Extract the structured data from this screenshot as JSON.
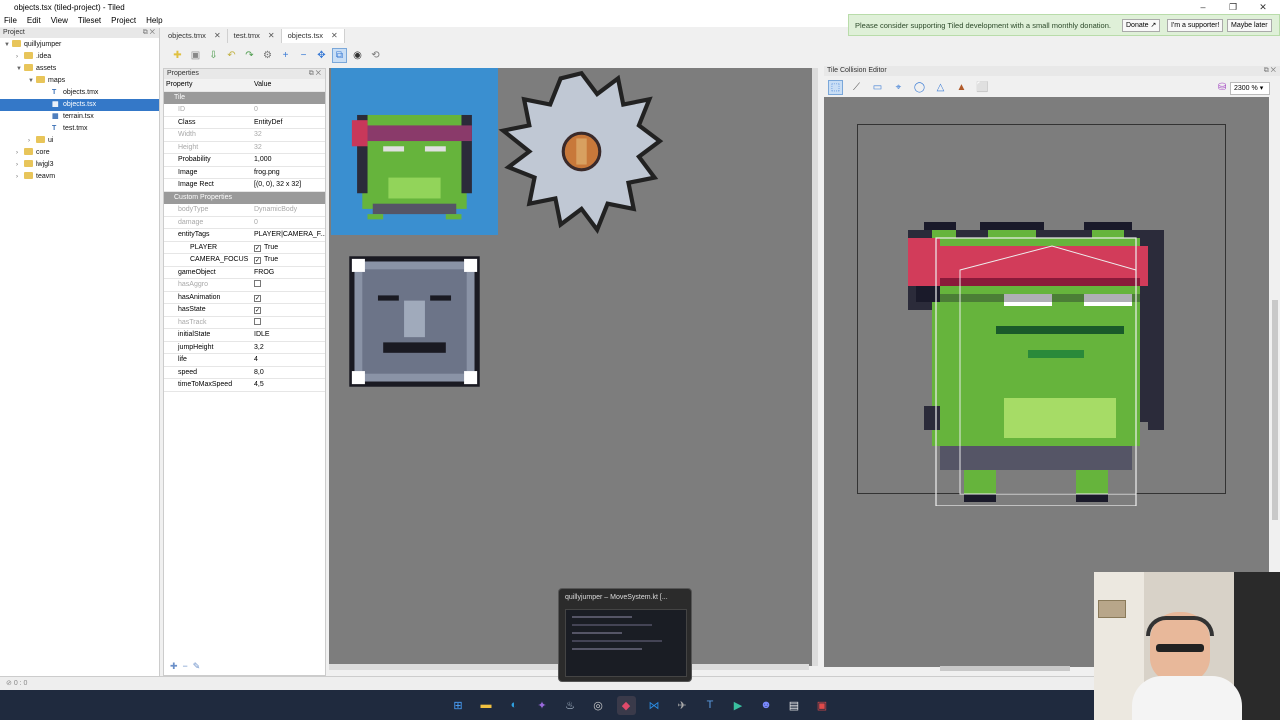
{
  "window": {
    "title": "objects.tsx (tiled-project) - Tiled"
  },
  "menu": [
    "File",
    "Edit",
    "View",
    "Tileset",
    "Project",
    "Help"
  ],
  "banner": {
    "text": "Please consider supporting Tiled development with a small monthly donation.",
    "donate": "Donate ↗",
    "supporter": "I'm a supporter!",
    "later": "Maybe later"
  },
  "tabs": [
    {
      "label": "objects.tmx"
    },
    {
      "label": "test.tmx"
    },
    {
      "label": "objects.tsx"
    }
  ],
  "project": {
    "header": "Project",
    "tree": [
      {
        "label": "quillyjumper",
        "type": "folder"
      },
      {
        "label": ".idea",
        "type": "folder"
      },
      {
        "label": "assets",
        "type": "folder"
      },
      {
        "label": "maps",
        "type": "folder"
      },
      {
        "label": "objects.tmx",
        "type": "file"
      },
      {
        "label": "objects.tsx",
        "type": "file"
      },
      {
        "label": "terrain.tsx",
        "type": "file"
      },
      {
        "label": "test.tmx",
        "type": "file"
      },
      {
        "label": "ui",
        "type": "folder"
      },
      {
        "label": "core",
        "type": "folder"
      },
      {
        "label": "lwjgl3",
        "type": "folder"
      },
      {
        "label": "teavm",
        "type": "folder"
      }
    ]
  },
  "properties": {
    "header": "Properties",
    "col_property": "Property",
    "col_value": "Value",
    "rows": [
      {
        "name": "Tile",
        "value": "",
        "kind": "group"
      },
      {
        "name": "ID",
        "value": "0",
        "kind": "disabled"
      },
      {
        "name": "Class",
        "value": "EntityDef",
        "kind": "normal"
      },
      {
        "name": "Width",
        "value": "32",
        "kind": "disabled"
      },
      {
        "name": "Height",
        "value": "32",
        "kind": "disabled"
      },
      {
        "name": "Probability",
        "value": "1,000",
        "kind": "normal"
      },
      {
        "name": "Image",
        "value": "frog.png",
        "kind": "normal"
      },
      {
        "name": "Image Rect",
        "value": "[(0, 0), 32 x 32]",
        "kind": "normal"
      },
      {
        "name": "Custom Properties",
        "value": "",
        "kind": "group"
      },
      {
        "name": "bodyType",
        "value": "DynamicBody",
        "kind": "disabled"
      },
      {
        "name": "damage",
        "value": "0",
        "kind": "disabled"
      },
      {
        "name": "entityTags",
        "value": "PLAYER|CAMERA_F...",
        "kind": "normal"
      },
      {
        "name": "PLAYER",
        "value": "True",
        "kind": "check"
      },
      {
        "name": "CAMERA_FOCUS",
        "value": "True",
        "kind": "check"
      },
      {
        "name": "gameObject",
        "value": "FROG",
        "kind": "normal"
      },
      {
        "name": "hasAggro",
        "value": "",
        "kind": "disabled-check"
      },
      {
        "name": "hasAnimation",
        "value": "",
        "kind": "check"
      },
      {
        "name": "hasState",
        "value": "",
        "kind": "check"
      },
      {
        "name": "hasTrack",
        "value": "",
        "kind": "disabled-check"
      },
      {
        "name": "initialState",
        "value": "IDLE",
        "kind": "normal"
      },
      {
        "name": "jumpHeight",
        "value": "3,2",
        "kind": "normal"
      },
      {
        "name": "life",
        "value": "4",
        "kind": "normal"
      },
      {
        "name": "speed",
        "value": "8,0",
        "kind": "normal"
      },
      {
        "name": "timeToMaxSpeed",
        "value": "4,5",
        "kind": "normal"
      }
    ]
  },
  "collision": {
    "header": "Tile Collision Editor",
    "zoom": "2300 %"
  },
  "taskbar_preview": {
    "title": "quillyjumper – MoveSystem.kt [..."
  },
  "status": {
    "text": "0 : 0"
  },
  "colors": {
    "accent": "#3478c8",
    "canvas": "#7d7d7d",
    "frog": "#66b43c",
    "band": "#d23c5a"
  }
}
